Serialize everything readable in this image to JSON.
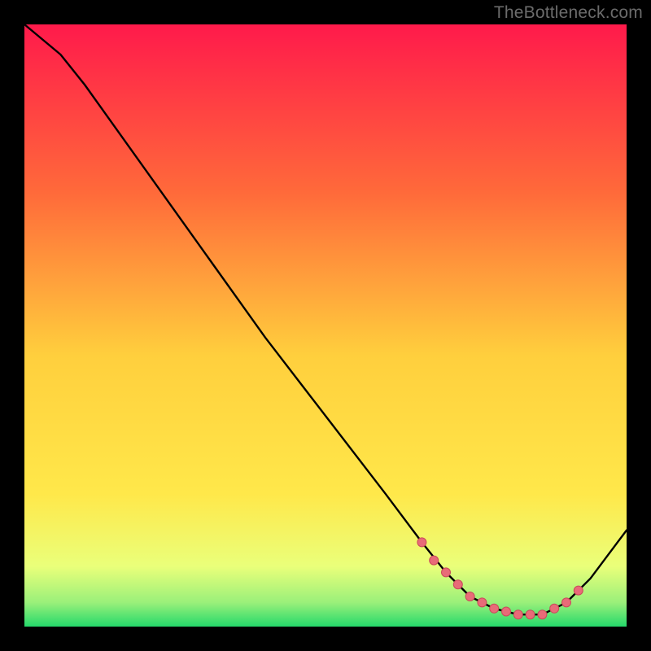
{
  "watermark": "TheBottleneck.com",
  "colors": {
    "bg_black": "#000000",
    "grad_top": "#ff1a4b",
    "grad_mid1": "#ff7a2e",
    "grad_mid2": "#ffe84a",
    "grad_low": "#f7ff8a",
    "grad_green": "#25d96b",
    "curve": "#000000",
    "marker_fill": "#e86b78",
    "marker_stroke": "#c94a5a"
  },
  "chart_data": {
    "type": "line",
    "title": "",
    "xlabel": "",
    "ylabel": "",
    "xlim": [
      0,
      100
    ],
    "ylim": [
      0,
      100
    ],
    "series": [
      {
        "name": "curve",
        "x": [
          0,
          6,
          10,
          20,
          30,
          40,
          50,
          60,
          66,
          70,
          74,
          78,
          82,
          86,
          90,
          94,
          100
        ],
        "y": [
          100,
          95,
          90,
          76,
          62,
          48,
          35,
          22,
          14,
          9,
          5,
          3,
          2,
          2,
          4,
          8,
          16
        ]
      }
    ],
    "markers": {
      "name": "optimal-range",
      "x": [
        66,
        68,
        70,
        72,
        74,
        76,
        78,
        80,
        82,
        84,
        86,
        88,
        90,
        92
      ],
      "y": [
        14,
        11,
        9,
        7,
        5,
        4,
        3,
        2.5,
        2,
        2,
        2,
        3,
        4,
        6
      ]
    }
  }
}
